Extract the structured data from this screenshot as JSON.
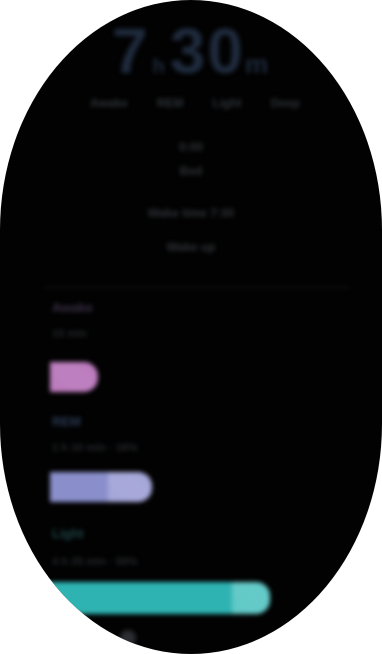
{
  "sleep": {
    "duration_hours": "7",
    "hour_unit": "h",
    "duration_minutes": "30",
    "minute_unit": "m",
    "stage_labels": [
      "Awake",
      "REM",
      "Light",
      "Deep"
    ],
    "bedtime": "0:00",
    "bedtime_caption": "Bed",
    "wake_time": "Wake time 7:30",
    "wake_caption": "Wake up"
  },
  "stages": [
    {
      "title": "Awake",
      "subtitle": "15 min",
      "color": "#b670b8",
      "fill_fraction": 0.2
    },
    {
      "title": "REM",
      "subtitle": "1 h 10 min · 16%",
      "color": "#8a8fcb",
      "fill_fraction": 0.46
    },
    {
      "title": "Light",
      "subtitle": "4 h 25 min · 59%",
      "color": "#2fb3b2",
      "fill_fraction": 0.96
    }
  ],
  "colors": {
    "background": "#020202",
    "title_tint": "#1e2a3c"
  }
}
